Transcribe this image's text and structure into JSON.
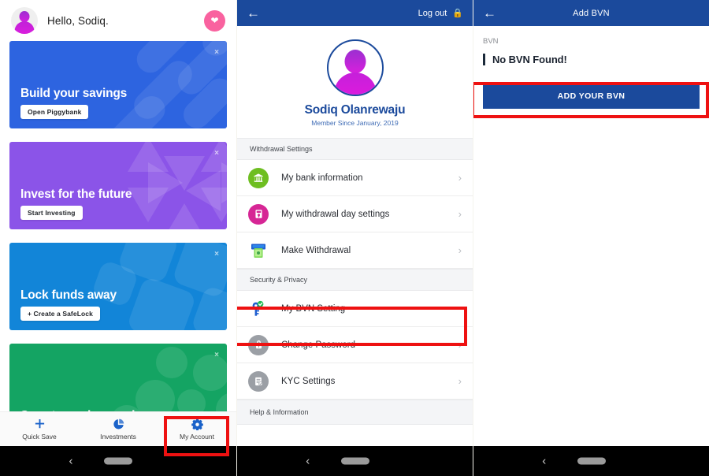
{
  "panel_home": {
    "greeting": "Hello, Sodiq.",
    "heart_icon": "heart-icon",
    "close_icon": "×",
    "promos": [
      {
        "title": "Build your savings",
        "button": "Open Piggybank",
        "color": "#2d64e0"
      },
      {
        "title": "Invest for the future",
        "button": "Start Investing",
        "color": "#8b54e8"
      },
      {
        "title": "Lock funds away",
        "button": "+ Create a SafeLock",
        "color": "#1285d8"
      },
      {
        "title": "Save towards a goal",
        "button": "",
        "color": "#14a463"
      }
    ],
    "bottom_nav": [
      {
        "label": "Quick Save",
        "icon": "plus-icon"
      },
      {
        "label": "Investments",
        "icon": "pie-chart-icon"
      },
      {
        "label": "My Account",
        "icon": "gear-icon"
      }
    ]
  },
  "panel_account": {
    "topbar": {
      "back_icon": "arrow-left-icon",
      "logout": "Log out",
      "lock_icon": "lock-icon"
    },
    "profile": {
      "name": "Sodiq Olanrewaju",
      "member_since": "Member Since January, 2019"
    },
    "sections": [
      {
        "heading": "Withdrawal Settings",
        "rows": [
          {
            "label": "My bank information",
            "icon": "bank-icon",
            "icon_style": "green"
          },
          {
            "label": "My withdrawal day settings",
            "icon": "atm-icon",
            "icon_style": "pink"
          },
          {
            "label": "Make Withdrawal",
            "icon": "money-out-icon",
            "icon_style": "flat"
          }
        ]
      },
      {
        "heading": "Security & Privacy",
        "rows": [
          {
            "label": "My BVN Setting",
            "icon": "key-icon",
            "icon_style": "flat"
          },
          {
            "label": "Change Password",
            "icon": "padlock-icon",
            "icon_style": "grey"
          },
          {
            "label": "KYC Settings",
            "icon": "document-icon",
            "icon_style": "grey"
          }
        ]
      },
      {
        "heading": "Help & Information",
        "rows": []
      }
    ],
    "chevron_icon": "chevron-right-icon"
  },
  "panel_bvn": {
    "topbar": {
      "back_icon": "arrow-left-icon",
      "title": "Add BVN"
    },
    "field_label": "BVN",
    "field_value": "No BVN Found!",
    "cta": "ADD YOUR BVN"
  },
  "navbar": {
    "back_icon": "‹",
    "home_pill": "home-pill"
  },
  "colors": {
    "brand_blue": "#1b4a9c",
    "accent_pink": "#f9629f",
    "highlight_red": "#ee1111"
  }
}
